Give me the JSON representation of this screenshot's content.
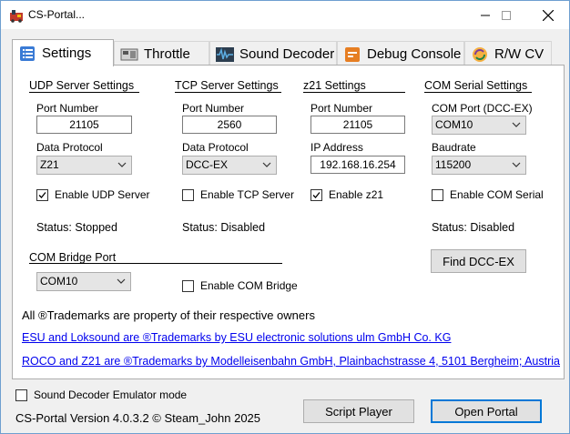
{
  "window": {
    "title": "CS-Portal..."
  },
  "tabs": [
    {
      "label": "Settings",
      "icon": "list-icon"
    },
    {
      "label": "Throttle",
      "icon": "throttle-icon"
    },
    {
      "label": "Sound Decoder",
      "icon": "waveform-icon"
    },
    {
      "label": "Debug Console",
      "icon": "debug-icon"
    },
    {
      "label": "R/W CV",
      "icon": "sync-icon"
    }
  ],
  "udp": {
    "title": "UDP Server Settings",
    "port_label": "Port Number",
    "port_value": "21105",
    "protocol_label": "Data Protocol",
    "protocol_value": "Z21",
    "enable_label": "Enable UDP Server",
    "enabled": true,
    "status": "Status: Stopped"
  },
  "tcp": {
    "title": "TCP Server Settings",
    "port_label": "Port Number",
    "port_value": "2560",
    "protocol_label": "Data Protocol",
    "protocol_value": "DCC-EX",
    "enable_label": "Enable TCP Server",
    "enabled": false,
    "status": "Status: Disabled"
  },
  "z21": {
    "title": "z21 Settings",
    "port_label": "Port Number",
    "port_value": "21105",
    "ip_label": "IP Address",
    "ip_value": "192.168.16.254",
    "enable_label": "Enable z21",
    "enabled": true
  },
  "com": {
    "title": "COM Serial Settings",
    "port_label": "COM Port (DCC-EX)",
    "port_value": "COM10",
    "baud_label": "Baudrate",
    "baud_value": "115200",
    "enable_label": "Enable COM Serial",
    "enabled": false,
    "status": "Status: Disabled",
    "find_button": "Find DCC-EX"
  },
  "bridge": {
    "title": "COM Bridge Port",
    "port_value": "COM10",
    "enable_label": "Enable COM Bridge",
    "enabled": false
  },
  "trademarks": {
    "notice": "All ®Trademarks are property of their respective owners",
    "esu_link": "ESU and Loksound are ®Trademarks by ESU electronic solutions ulm GmbH  Co. KG",
    "roco_link": "ROCO and Z21 are ®Trademarks by Modelleisenbahn GmbH, Plainbachstrasse 4, 5101 Bergheim; Austria"
  },
  "footer": {
    "emulator_label": "Sound Decoder Emulator mode",
    "emulator_enabled": false,
    "version": "CS-Portal Version 4.0.3.2  © Steam_John 2025",
    "script_button": "Script Player",
    "open_button": "Open Portal"
  },
  "colors": {
    "accent": "#0078d7",
    "link": "#0000ee",
    "window_bg": "#f0f0f0"
  }
}
